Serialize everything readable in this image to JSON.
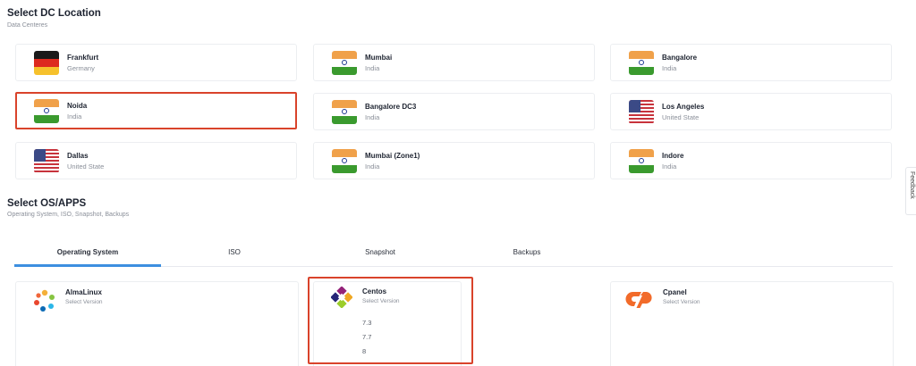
{
  "dc_section": {
    "title": "Select DC Location",
    "subtitle": "Data Centeres"
  },
  "locations": [
    {
      "city": "Frankfurt",
      "country": "Germany",
      "flag": "germany-flag"
    },
    {
      "city": "Mumbai",
      "country": "India",
      "flag": "india-flag"
    },
    {
      "city": "Bangalore",
      "country": "India",
      "flag": "india-flag"
    },
    {
      "city": "Noida",
      "country": "India",
      "flag": "india-flag",
      "selected": true
    },
    {
      "city": "Bangalore DC3",
      "country": "India",
      "flag": "india-flag"
    },
    {
      "city": "Los Angeles",
      "country": "United State",
      "flag": "usa-flag"
    },
    {
      "city": "Dallas",
      "country": "United State",
      "flag": "usa-flag"
    },
    {
      "city": "Mumbai (Zone1)",
      "country": "India",
      "flag": "india-flag"
    },
    {
      "city": "Indore",
      "country": "India",
      "flag": "india-flag"
    }
  ],
  "os_section": {
    "title": "Select OS/APPS",
    "subtitle": "Operating System, ISO, Snapshot, Backups"
  },
  "tabs": [
    {
      "label": "Operating System",
      "active": true
    },
    {
      "label": "ISO"
    },
    {
      "label": "Snapshot"
    },
    {
      "label": "Backups"
    }
  ],
  "os_cards": [
    {
      "name": "AlmaLinux",
      "subtitle": "Select Version",
      "icon": "almalinux-logo-icon"
    },
    {
      "name": "Centos",
      "subtitle": "Select Version",
      "icon": "centos-logo-icon",
      "selected": true,
      "versions": [
        "7.3",
        "7.7",
        "8"
      ]
    },
    {
      "name": "Cpanel",
      "subtitle": "Select Version",
      "icon": "cpanel-logo-icon"
    }
  ],
  "feedback": {
    "label": "Feedback"
  },
  "colors": {
    "selected_border": "#d9432b",
    "tab_accent": "#3d8fe0",
    "cpanel_orange": "#f26b2a"
  }
}
